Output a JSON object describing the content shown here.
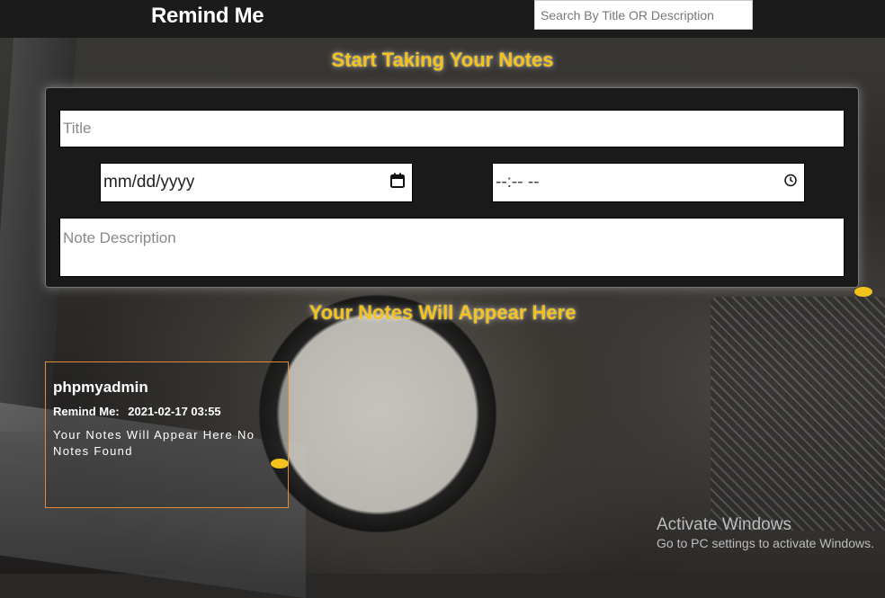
{
  "header": {
    "brand": "Remind Me",
    "search_placeholder": "Search By Title OR Description"
  },
  "form": {
    "heading": "Start Taking Your Notes",
    "title_placeholder": "Title",
    "date_placeholder": "mm/dd/yyyy",
    "time_placeholder": "--:-- --",
    "description_placeholder": "Note Description",
    "date_icon": "calendar-icon",
    "time_icon": "clock-icon"
  },
  "notes": {
    "heading": "Your Notes Will Appear Here",
    "items": [
      {
        "title": "phpmyadmin",
        "remind_label": "Remind Me:",
        "remind_value": "2021-02-17 03:55",
        "description": "Your Notes Will Appear Here No Notes Found"
      }
    ]
  },
  "watermark": {
    "title": "Activate Windows",
    "subtitle": "Go to PC settings to activate Windows."
  },
  "colors": {
    "accent": "#f3c21c",
    "navbar": "#1b1b1b",
    "card_border": "#e08a3c"
  }
}
